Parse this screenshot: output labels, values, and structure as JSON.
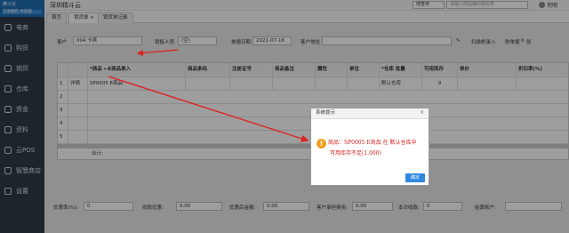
{
  "app": {
    "title": "深圳精斗云",
    "logo_line1": "精斗云",
    "logo_line2": "云进销存 体验版"
  },
  "sidebar": {
    "items": [
      {
        "label": "电商",
        "icon": "cart-icon"
      },
      {
        "label": "购货",
        "icon": "purchase-icon"
      },
      {
        "label": "销货",
        "icon": "sales-icon"
      },
      {
        "label": "仓库",
        "icon": "warehouse-icon"
      },
      {
        "label": "资金",
        "icon": "money-icon"
      },
      {
        "label": "资料",
        "icon": "data-icon"
      },
      {
        "label": "云POS",
        "icon": "pos-icon"
      },
      {
        "label": "智慧商店",
        "icon": "store-icon"
      },
      {
        "label": "设置",
        "icon": "settings-icon"
      }
    ]
  },
  "topbar": {
    "search_scope": "搜查存",
    "search_placeholder": "请输入商品编码或名称",
    "user": "司明"
  },
  "tabs": [
    {
      "label": "首页"
    },
    {
      "label": "销货单 ×"
    },
    {
      "label": "销货单记录"
    }
  ],
  "form": {
    "customer_label": "客户",
    "customer_value": "004 卡宾",
    "salesperson_label": "销售人员",
    "salesperson_value": "(空)",
    "date_label": "单据日期",
    "date_value": "2021-07-16",
    "address_label": "客户地址",
    "scan_label": "扫描枪录入",
    "bill_no_label": "附单据",
    "bill_no_value": "0",
    "bill_no_unit": "张"
  },
  "table": {
    "headers": [
      "",
      "",
      "*商品 ←E商品录入",
      "商品条码",
      "注册证号",
      "商品备注",
      "属性",
      "单位",
      "*仓库 批量",
      "可用库存",
      "单价",
      "折扣率(%)"
    ],
    "rows": [
      {
        "no": "1",
        "action": "详情",
        "product": "SP0005 E商品",
        "barcode": "",
        "reg": "",
        "note": "",
        "attr": "",
        "unit": "",
        "warehouse": "默认仓库",
        "stock": "9",
        "price": "",
        "discount": ""
      },
      {
        "no": "2",
        "action": "",
        "product": "",
        "barcode": "",
        "reg": "",
        "note": "",
        "attr": "",
        "unit": "",
        "warehouse": "",
        "stock": "",
        "price": "",
        "discount": ""
      },
      {
        "no": "3",
        "action": "",
        "product": "",
        "barcode": "",
        "reg": "",
        "note": "",
        "attr": "",
        "unit": "",
        "warehouse": "",
        "stock": "",
        "price": "",
        "discount": ""
      },
      {
        "no": "4",
        "action": "",
        "product": "",
        "barcode": "",
        "reg": "",
        "note": "",
        "attr": "",
        "unit": "",
        "warehouse": "",
        "stock": "",
        "price": "",
        "discount": ""
      },
      {
        "no": "5",
        "action": "",
        "product": "",
        "barcode": "",
        "reg": "",
        "note": "",
        "attr": "",
        "unit": "",
        "warehouse": "",
        "stock": "",
        "price": "",
        "discount": ""
      }
    ],
    "total_label": "合计:"
  },
  "bottom": {
    "discount_rate_label": "优惠率(%):",
    "discount_rate_value": "0",
    "discount_amount_label": "收款优惠:",
    "discount_amount_value": "0.00",
    "after_discount_label": "优惠后金额:",
    "after_discount_value": "0.00",
    "customer_fee_label": "客户承担费用:",
    "customer_fee_value": "0.00",
    "receive_label": "本次收款:",
    "receive_value": "0",
    "settle_label": "结算账户:"
  },
  "modal": {
    "title": "系统提示",
    "line1": "商品：SP0005 E商品 在 默认仓库中",
    "line2": "可用库存不足(1.000)",
    "ok": "确定"
  },
  "colors": {
    "sidebar": "#2f3a47",
    "accent": "#2f88df",
    "warning": "#f0a020",
    "alert_text": "#d0201e"
  }
}
